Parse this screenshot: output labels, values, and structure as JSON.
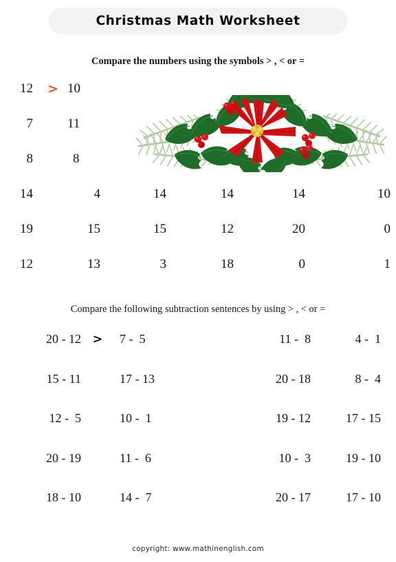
{
  "worksheet": {
    "title": "Christmas Math Worksheet",
    "footer": "copyright:  www.mathinenglish.com",
    "accent_color": "#e2622c",
    "title_pill_color": "#f2f2f4"
  },
  "section_numbers": {
    "instruction": "Compare the  numbers using the symbols  > , < or  =",
    "example_symbol": ">",
    "rows": [
      {
        "cells": [
          "12",
          "10"
        ],
        "has_example": true
      },
      {
        "cells": [
          "7",
          "11"
        ],
        "has_example": false
      },
      {
        "cells": [
          "8",
          "8"
        ],
        "has_example": false
      },
      {
        "cells": [
          "14",
          "4",
          "14",
          "14",
          "14",
          "10"
        ],
        "has_example": false
      },
      {
        "cells": [
          "19",
          "15",
          "15",
          "12",
          "20",
          "0"
        ],
        "has_example": false
      },
      {
        "cells": [
          "12",
          "13",
          "3",
          "18",
          "0",
          "1"
        ],
        "has_example": false
      }
    ]
  },
  "section_subtraction": {
    "instruction": "Compare the following subtraction sentences by using > , < or  =",
    "example_symbol": ">",
    "rows": [
      {
        "cells": [
          "20 - 12",
          "7 -  5",
          "11 -  8",
          "4 -  1"
        ],
        "has_example": true
      },
      {
        "cells": [
          "15 - 11",
          "17 - 13",
          "20 - 18",
          "8 -  4"
        ],
        "has_example": false
      },
      {
        "cells": [
          "12 -  5",
          "10 -  1",
          "19 - 12",
          "17 - 15"
        ],
        "has_example": false
      },
      {
        "cells": [
          "20 - 19",
          "11 -  6",
          "10 -  3",
          "19 - 10"
        ],
        "has_example": false
      },
      {
        "cells": [
          "18 - 10",
          "14 -  7",
          "20 - 17",
          "17 - 10"
        ],
        "has_example": false
      }
    ]
  },
  "decoration": {
    "name": "poinsettia-holly-garland"
  }
}
